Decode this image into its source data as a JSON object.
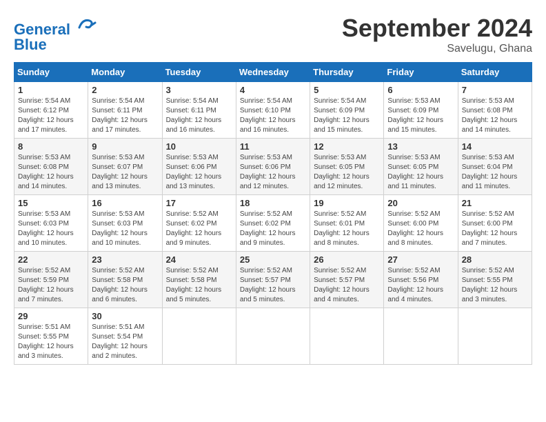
{
  "header": {
    "logo_text1": "General",
    "logo_text2": "Blue",
    "month": "September 2024",
    "location": "Savelugu, Ghana"
  },
  "days_of_week": [
    "Sunday",
    "Monday",
    "Tuesday",
    "Wednesday",
    "Thursday",
    "Friday",
    "Saturday"
  ],
  "weeks": [
    [
      {
        "day": "1",
        "sunrise": "5:54 AM",
        "sunset": "6:12 PM",
        "daylight": "12 hours and 17 minutes."
      },
      {
        "day": "2",
        "sunrise": "5:54 AM",
        "sunset": "6:11 PM",
        "daylight": "12 hours and 17 minutes."
      },
      {
        "day": "3",
        "sunrise": "5:54 AM",
        "sunset": "6:11 PM",
        "daylight": "12 hours and 16 minutes."
      },
      {
        "day": "4",
        "sunrise": "5:54 AM",
        "sunset": "6:10 PM",
        "daylight": "12 hours and 16 minutes."
      },
      {
        "day": "5",
        "sunrise": "5:54 AM",
        "sunset": "6:09 PM",
        "daylight": "12 hours and 15 minutes."
      },
      {
        "day": "6",
        "sunrise": "5:53 AM",
        "sunset": "6:09 PM",
        "daylight": "12 hours and 15 minutes."
      },
      {
        "day": "7",
        "sunrise": "5:53 AM",
        "sunset": "6:08 PM",
        "daylight": "12 hours and 14 minutes."
      }
    ],
    [
      {
        "day": "8",
        "sunrise": "5:53 AM",
        "sunset": "6:08 PM",
        "daylight": "12 hours and 14 minutes."
      },
      {
        "day": "9",
        "sunrise": "5:53 AM",
        "sunset": "6:07 PM",
        "daylight": "12 hours and 13 minutes."
      },
      {
        "day": "10",
        "sunrise": "5:53 AM",
        "sunset": "6:06 PM",
        "daylight": "12 hours and 13 minutes."
      },
      {
        "day": "11",
        "sunrise": "5:53 AM",
        "sunset": "6:06 PM",
        "daylight": "12 hours and 12 minutes."
      },
      {
        "day": "12",
        "sunrise": "5:53 AM",
        "sunset": "6:05 PM",
        "daylight": "12 hours and 12 minutes."
      },
      {
        "day": "13",
        "sunrise": "5:53 AM",
        "sunset": "6:05 PM",
        "daylight": "12 hours and 11 minutes."
      },
      {
        "day": "14",
        "sunrise": "5:53 AM",
        "sunset": "6:04 PM",
        "daylight": "12 hours and 11 minutes."
      }
    ],
    [
      {
        "day": "15",
        "sunrise": "5:53 AM",
        "sunset": "6:03 PM",
        "daylight": "12 hours and 10 minutes."
      },
      {
        "day": "16",
        "sunrise": "5:53 AM",
        "sunset": "6:03 PM",
        "daylight": "12 hours and 10 minutes."
      },
      {
        "day": "17",
        "sunrise": "5:52 AM",
        "sunset": "6:02 PM",
        "daylight": "12 hours and 9 minutes."
      },
      {
        "day": "18",
        "sunrise": "5:52 AM",
        "sunset": "6:02 PM",
        "daylight": "12 hours and 9 minutes."
      },
      {
        "day": "19",
        "sunrise": "5:52 AM",
        "sunset": "6:01 PM",
        "daylight": "12 hours and 8 minutes."
      },
      {
        "day": "20",
        "sunrise": "5:52 AM",
        "sunset": "6:00 PM",
        "daylight": "12 hours and 8 minutes."
      },
      {
        "day": "21",
        "sunrise": "5:52 AM",
        "sunset": "6:00 PM",
        "daylight": "12 hours and 7 minutes."
      }
    ],
    [
      {
        "day": "22",
        "sunrise": "5:52 AM",
        "sunset": "5:59 PM",
        "daylight": "12 hours and 7 minutes."
      },
      {
        "day": "23",
        "sunrise": "5:52 AM",
        "sunset": "5:58 PM",
        "daylight": "12 hours and 6 minutes."
      },
      {
        "day": "24",
        "sunrise": "5:52 AM",
        "sunset": "5:58 PM",
        "daylight": "12 hours and 5 minutes."
      },
      {
        "day": "25",
        "sunrise": "5:52 AM",
        "sunset": "5:57 PM",
        "daylight": "12 hours and 5 minutes."
      },
      {
        "day": "26",
        "sunrise": "5:52 AM",
        "sunset": "5:57 PM",
        "daylight": "12 hours and 4 minutes."
      },
      {
        "day": "27",
        "sunrise": "5:52 AM",
        "sunset": "5:56 PM",
        "daylight": "12 hours and 4 minutes."
      },
      {
        "day": "28",
        "sunrise": "5:52 AM",
        "sunset": "5:55 PM",
        "daylight": "12 hours and 3 minutes."
      }
    ],
    [
      {
        "day": "29",
        "sunrise": "5:51 AM",
        "sunset": "5:55 PM",
        "daylight": "12 hours and 3 minutes."
      },
      {
        "day": "30",
        "sunrise": "5:51 AM",
        "sunset": "5:54 PM",
        "daylight": "12 hours and 2 minutes."
      },
      null,
      null,
      null,
      null,
      null
    ]
  ],
  "labels": {
    "sunrise": "Sunrise:",
    "sunset": "Sunset:",
    "daylight": "Daylight:"
  }
}
